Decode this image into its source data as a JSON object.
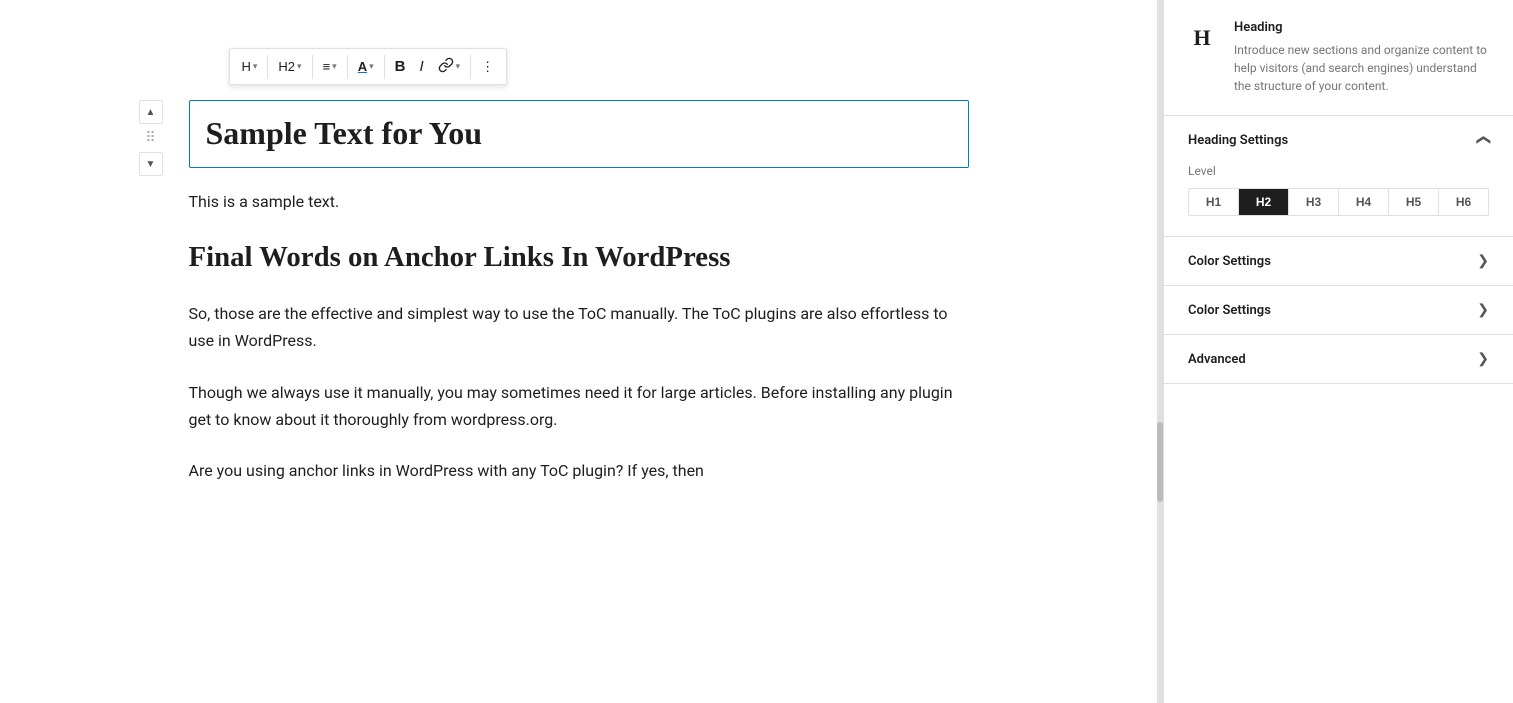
{
  "toolbar": {
    "heading_label": "H",
    "heading_level": "H2",
    "align_icon": "≡",
    "text_color_icon": "A",
    "bold_label": "B",
    "italic_label": "I",
    "link_icon": "🔗",
    "more_icon": "⋮",
    "chevron": "▾"
  },
  "editor": {
    "heading_text": "Sample Text for You",
    "paragraph1": "This is a sample text.",
    "heading2": "Final Words on Anchor Links In WordPress",
    "paragraph2": "So, those are the effective and simplest way to use the ToC manually. The ToC plugins are also effortless to use in WordPress.",
    "paragraph3": "Though we always use it manually, you may sometimes need it for large articles. Before installing any plugin get to know about it thoroughly from wordpress.org.",
    "paragraph4": "Are you using anchor links in WordPress with any ToC plugin? If yes, then"
  },
  "sidebar": {
    "block_icon": "H",
    "block_title": "Heading",
    "block_description": "Introduce new sections and organize content to help visitors (and search engines) understand the structure of your content.",
    "heading_settings_label": "Heading Settings",
    "level_label": "Level",
    "levels": [
      "H1",
      "H2",
      "H3",
      "H4",
      "H5",
      "H6"
    ],
    "active_level": "H2",
    "color_settings_label1": "Color Settings",
    "color_settings_label2": "Color Settings",
    "advanced_label": "Advanced",
    "chevron_down": "❯",
    "chevron_up": "❮"
  }
}
